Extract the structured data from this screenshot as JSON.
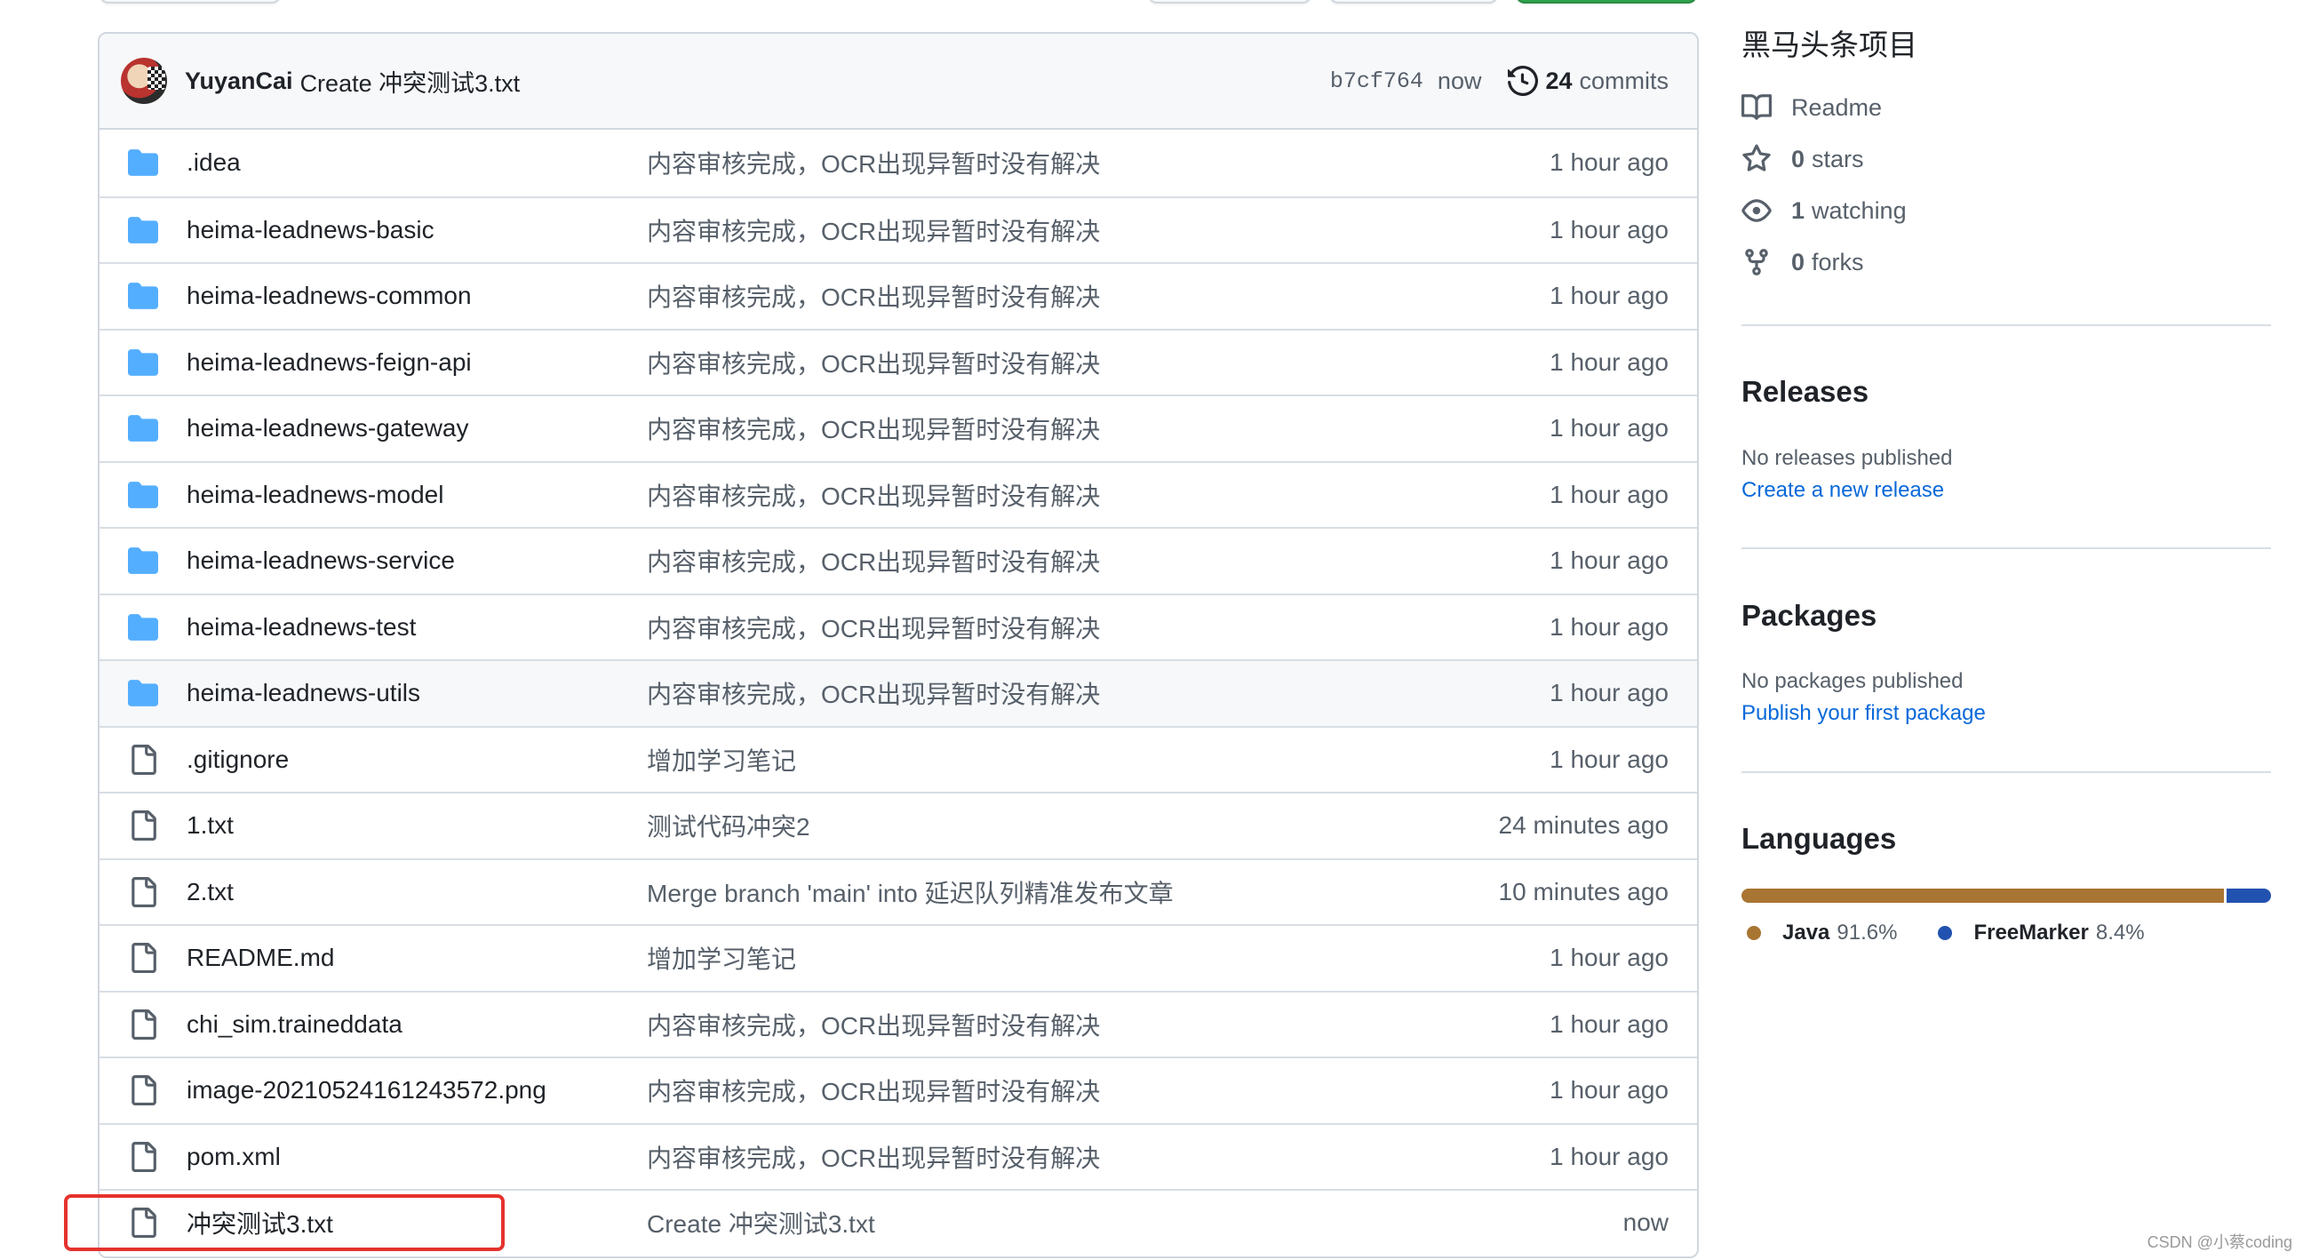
{
  "top_buttons": [
    {
      "name": "branch-button"
    },
    {
      "name": "go-to-file-button"
    },
    {
      "name": "add-file-button"
    },
    {
      "name": "code-button"
    }
  ],
  "latest_commit": {
    "author": "YuyanCai",
    "message": "Create 冲突测试3.txt",
    "sha": "b7cf764",
    "time": "now",
    "commits_count": "24",
    "commits_label": "commits"
  },
  "files": [
    {
      "type": "folder",
      "name": ".idea",
      "message": "内容审核完成，OCR出现异暂时没有解决",
      "age": "1 hour ago"
    },
    {
      "type": "folder",
      "name": "heima-leadnews-basic",
      "message": "内容审核完成，OCR出现异暂时没有解决",
      "age": "1 hour ago"
    },
    {
      "type": "folder",
      "name": "heima-leadnews-common",
      "message": "内容审核完成，OCR出现异暂时没有解决",
      "age": "1 hour ago"
    },
    {
      "type": "folder",
      "name": "heima-leadnews-feign-api",
      "message": "内容审核完成，OCR出现异暂时没有解决",
      "age": "1 hour ago"
    },
    {
      "type": "folder",
      "name": "heima-leadnews-gateway",
      "message": "内容审核完成，OCR出现异暂时没有解决",
      "age": "1 hour ago"
    },
    {
      "type": "folder",
      "name": "heima-leadnews-model",
      "message": "内容审核完成，OCR出现异暂时没有解决",
      "age": "1 hour ago"
    },
    {
      "type": "folder",
      "name": "heima-leadnews-service",
      "message": "内容审核完成，OCR出现异暂时没有解决",
      "age": "1 hour ago"
    },
    {
      "type": "folder",
      "name": "heima-leadnews-test",
      "message": "内容审核完成，OCR出现异暂时没有解决",
      "age": "1 hour ago"
    },
    {
      "type": "folder",
      "name": "heima-leadnews-utils",
      "message": "内容审核完成，OCR出现异暂时没有解决",
      "age": "1 hour ago",
      "hover": true
    },
    {
      "type": "file",
      "name": ".gitignore",
      "message": "增加学习笔记",
      "age": "1 hour ago"
    },
    {
      "type": "file",
      "name": "1.txt",
      "message": "测试代码冲突2",
      "age": "24 minutes ago"
    },
    {
      "type": "file",
      "name": "2.txt",
      "message": "Merge branch 'main' into 延迟队列精准发布文章",
      "age": "10 minutes ago"
    },
    {
      "type": "file",
      "name": "README.md",
      "message": "增加学习笔记",
      "age": "1 hour ago"
    },
    {
      "type": "file",
      "name": "chi_sim.traineddata",
      "message": "内容审核完成，OCR出现异暂时没有解决",
      "age": "1 hour ago"
    },
    {
      "type": "file",
      "name": "image-20210524161243572.png",
      "message": "内容审核完成，OCR出现异暂时没有解决",
      "age": "1 hour ago"
    },
    {
      "type": "file",
      "name": "pom.xml",
      "message": "内容审核完成，OCR出现异暂时没有解决",
      "age": "1 hour ago"
    },
    {
      "type": "file",
      "name": "冲突测试3.txt",
      "message": "Create 冲突测试3.txt",
      "age": "now",
      "highlighted": true
    }
  ],
  "about": {
    "description": "黑马头条项目",
    "readme_label": "Readme",
    "stars_count": "0",
    "stars_label": "stars",
    "watching_count": "1",
    "watching_label": "watching",
    "forks_count": "0",
    "forks_label": "forks"
  },
  "releases": {
    "title": "Releases",
    "empty_text": "No releases published",
    "link": "Create a new release"
  },
  "packages": {
    "title": "Packages",
    "empty_text": "No packages published",
    "link": "Publish your first package"
  },
  "languages": {
    "title": "Languages",
    "items": [
      {
        "name": "Java",
        "percent": "91.6%",
        "value": 91.6,
        "color": "#b07219"
      },
      {
        "name": "FreeMarker",
        "percent": "8.4%",
        "value": 8.4,
        "color": "#0050b3"
      }
    ]
  },
  "colors": {
    "highlight_box": "#e5322d",
    "folder_icon": "#54aeff",
    "link": "#0969da",
    "java": "#a87532",
    "freemarker": "#2252b0"
  },
  "watermark": "CSDN @小蔡coding"
}
